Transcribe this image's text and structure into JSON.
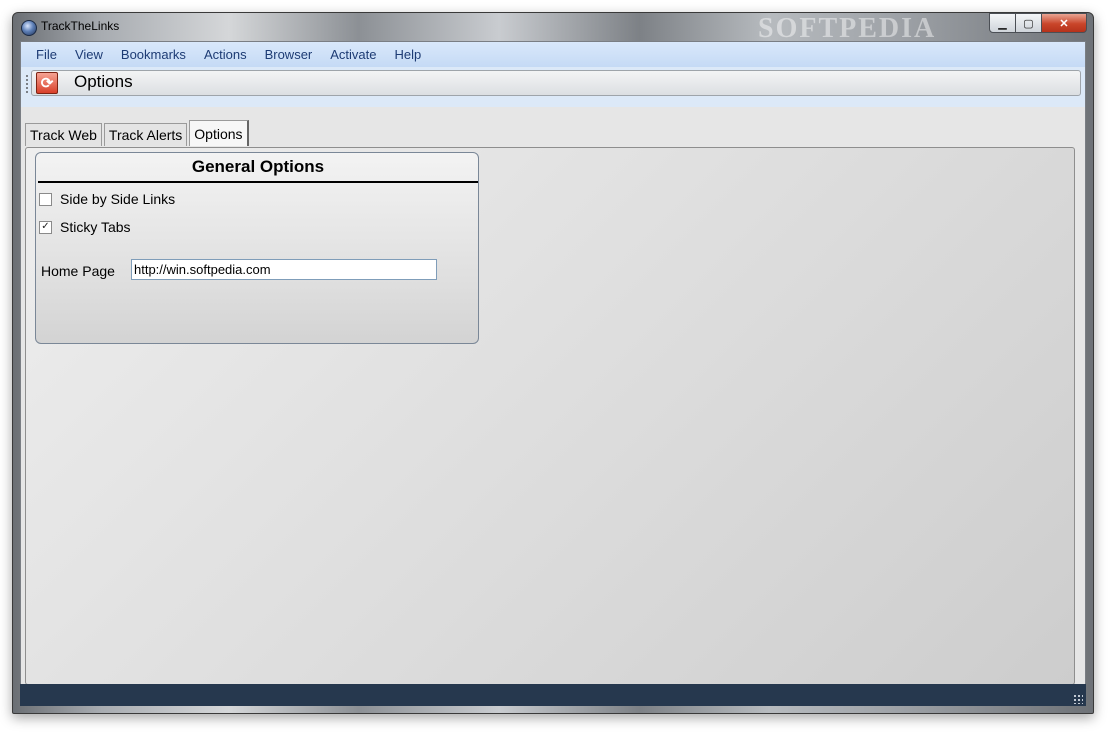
{
  "window": {
    "title": "TrackTheLinks",
    "watermark": "SOFTPEDIA",
    "controls": {
      "minimize": "▁",
      "maximize": "▢",
      "close": "✕"
    }
  },
  "menubar": {
    "items": [
      "File",
      "View",
      "Bookmarks",
      "Actions",
      "Browser",
      "Activate",
      "Help"
    ]
  },
  "toolbar": {
    "icon": "refresh-icon",
    "title": "Options"
  },
  "tabs": [
    {
      "label": "Track Web",
      "active": false
    },
    {
      "label": "Track Alerts",
      "active": false
    },
    {
      "label": "Options",
      "active": true
    }
  ],
  "general_options": {
    "title": "General Options",
    "side_by_side_links": {
      "label": "Side by Side Links",
      "checked": false
    },
    "sticky_tabs": {
      "label": "Sticky Tabs",
      "checked": true
    },
    "home_page": {
      "label": "Home Page",
      "value": "http://win.softpedia.com"
    }
  },
  "colors": {
    "menubar": "#c5daf5",
    "statusbar": "#26384e",
    "accent_icon": "#d9402a"
  }
}
